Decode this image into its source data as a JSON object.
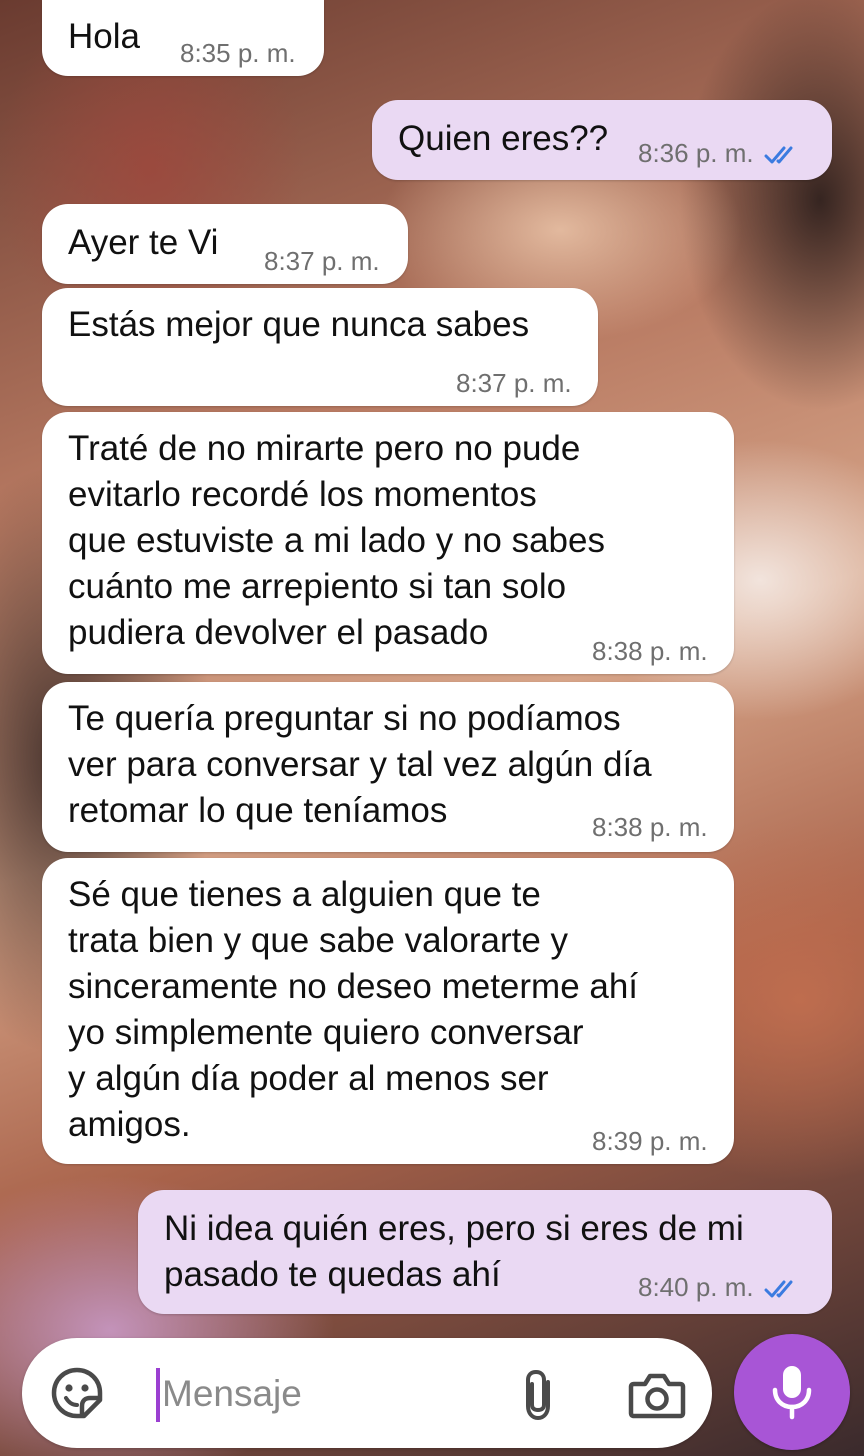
{
  "messages": [
    {
      "text": "Hola",
      "time": "8:35 p. m.",
      "direction": "incoming"
    },
    {
      "text": "Quien eres??",
      "time": "8:36 p. m.",
      "direction": "outgoing",
      "status": "read"
    },
    {
      "text": "Ayer te Vi",
      "time": "8:37 p. m.",
      "direction": "incoming"
    },
    {
      "text": "Estás mejor que nunca sabes",
      "time": "8:37 p. m.",
      "direction": "incoming"
    },
    {
      "text": "Traté de no mirarte pero no pude\nevitarlo recordé los momentos\nque estuviste a mi lado y no sabes\ncuánto me arrepiento si tan solo\npudiera devolver el pasado",
      "time": "8:38 p. m.",
      "direction": "incoming"
    },
    {
      "text": "Te quería preguntar si no podíamos\nver para conversar y tal vez algún día\nretomar lo que teníamos",
      "time": "8:38 p. m.",
      "direction": "incoming"
    },
    {
      "text": "Sé que tienes a alguien que te\ntrata bien y que sabe valorarte y\nsinceramente no deseo meterme ahí\nyo simplemente quiero conversar\ny algún día poder al menos ser\namigos.",
      "time": "8:39 p. m.",
      "direction": "incoming"
    },
    {
      "text": "Ni idea quién eres, pero si eres de mi\npasado te quedas ahí",
      "time": "8:40 p. m.",
      "direction": "outgoing",
      "status": "read"
    }
  ],
  "composer": {
    "placeholder": "Mensaje",
    "icons": [
      "sticker-emoji-icon",
      "paperclip-icon",
      "camera-icon",
      "microphone-icon"
    ]
  },
  "colors": {
    "incoming_bubble": "#ffffff",
    "outgoing_bubble": "#ead9f3",
    "read_tick": "#3b7be0",
    "mic_button": "#a855d6",
    "cursor": "#9b3fd1"
  }
}
